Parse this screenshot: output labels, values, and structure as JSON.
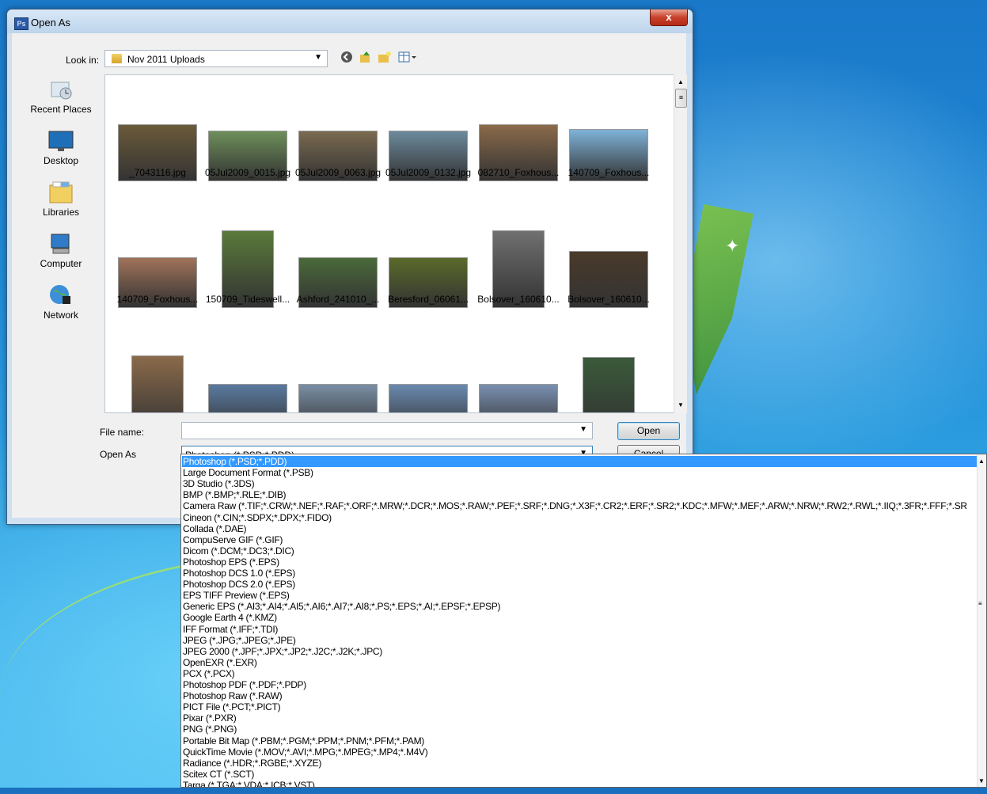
{
  "dialog": {
    "title": "Open As",
    "app_icon": "Ps",
    "close_label": "x",
    "look_in_label": "Look in:",
    "look_in_value": "Nov 2011 Uploads",
    "file_name_label": "File name:",
    "file_name_value": "",
    "open_as_label": "Open As",
    "open_as_value": "Photoshop (*.PSD;*.PDD)",
    "open_button": "Open",
    "cancel_button": "Cancel"
  },
  "toolbar_icons": [
    "back-icon",
    "up-folder-icon",
    "new-folder-icon",
    "view-menu-icon"
  ],
  "places": [
    {
      "label": "Recent Places",
      "icon": "recent-places-icon"
    },
    {
      "label": "Desktop",
      "icon": "desktop-icon"
    },
    {
      "label": "Libraries",
      "icon": "libraries-icon"
    },
    {
      "label": "Computer",
      "icon": "computer-icon"
    },
    {
      "label": "Network",
      "icon": "network-icon"
    }
  ],
  "files": [
    {
      "name": "_7043116.jpg",
      "color": "#6b5a3a"
    },
    {
      "name": "05Jul2009_0015.jpg",
      "color": "#6e8f5a"
    },
    {
      "name": "05Jul2009_0063.jpg",
      "color": "#7a6a50"
    },
    {
      "name": "05Jul2009_0132.jpg",
      "color": "#6c8a9c"
    },
    {
      "name": "082710_Foxhous...",
      "color": "#8a6a4a"
    },
    {
      "name": "140709_Foxhous...",
      "color": "#7fb3d8"
    },
    {
      "name": "140709_Foxhous...",
      "color": "#a0735a"
    },
    {
      "name": "150709_Tideswell...",
      "color": "#5a7a3a"
    },
    {
      "name": "Ashford_241010_...",
      "color": "#4a6a3a"
    },
    {
      "name": "Beresford_06061...",
      "color": "#5a6a2a"
    },
    {
      "name": "Bolsover_160610...",
      "color": "#707070"
    },
    {
      "name": "Bolsover_160610...",
      "color": "#4a3a2a"
    },
    {
      "name": "",
      "color": "#8a6a4a"
    },
    {
      "name": "",
      "color": "#5a7aa0"
    },
    {
      "name": "",
      "color": "#7a8fa6"
    },
    {
      "name": "",
      "color": "#6a8ab0"
    },
    {
      "name": "",
      "color": "#7a90b0"
    },
    {
      "name": "",
      "color": "#3a5a3a"
    }
  ],
  "format_options": [
    "Photoshop (*.PSD;*.PDD)",
    "Large Document Format (*.PSB)",
    "3D Studio (*.3DS)",
    "BMP (*.BMP;*.RLE;*.DIB)",
    "Camera Raw (*.TIF;*.CRW;*.NEF;*.RAF;*.ORF;*.MRW;*.DCR;*.MOS;*.RAW;*.PEF;*.SRF;*.DNG;*.X3F;*.CR2;*.ERF;*.SR2;*.KDC;*.MFW;*.MEF;*.ARW;*.NRW;*.RW2;*.RWL;*.IIQ;*.3FR;*.FFF;*.SR",
    "Cineon (*.CIN;*.SDPX;*.DPX;*.FIDO)",
    "Collada (*.DAE)",
    "CompuServe GIF (*.GIF)",
    "Dicom (*.DCM;*.DC3;*.DIC)",
    "Photoshop EPS (*.EPS)",
    "Photoshop DCS 1.0 (*.EPS)",
    "Photoshop DCS 2.0 (*.EPS)",
    "EPS TIFF Preview (*.EPS)",
    "Generic EPS (*.AI3;*.AI4;*.AI5;*.AI6;*.AI7;*.AI8;*.PS;*.EPS;*.AI;*.EPSF;*.EPSP)",
    "Google Earth 4 (*.KMZ)",
    "IFF Format (*.IFF;*.TDI)",
    "JPEG (*.JPG;*.JPEG;*.JPE)",
    "JPEG 2000 (*.JPF;*.JPX;*.JP2;*.J2C;*.J2K;*.JPC)",
    "OpenEXR (*.EXR)",
    "PCX (*.PCX)",
    "Photoshop PDF (*.PDF;*.PDP)",
    "Photoshop Raw (*.RAW)",
    "PICT File (*.PCT;*.PICT)",
    "Pixar (*.PXR)",
    "PNG (*.PNG)",
    "Portable Bit Map (*.PBM;*.PGM;*.PPM;*.PNM;*.PFM;*.PAM)",
    "QuickTime Movie (*.MOV;*.AVI;*.MPG;*.MPEG;*.MP4;*.M4V)",
    "Radiance (*.HDR;*.RGBE;*.XYZE)",
    "Scitex CT (*.SCT)",
    "Targa (*.TGA;*.VDA;*.ICB;*.VST)"
  ],
  "selected_format_index": 0
}
